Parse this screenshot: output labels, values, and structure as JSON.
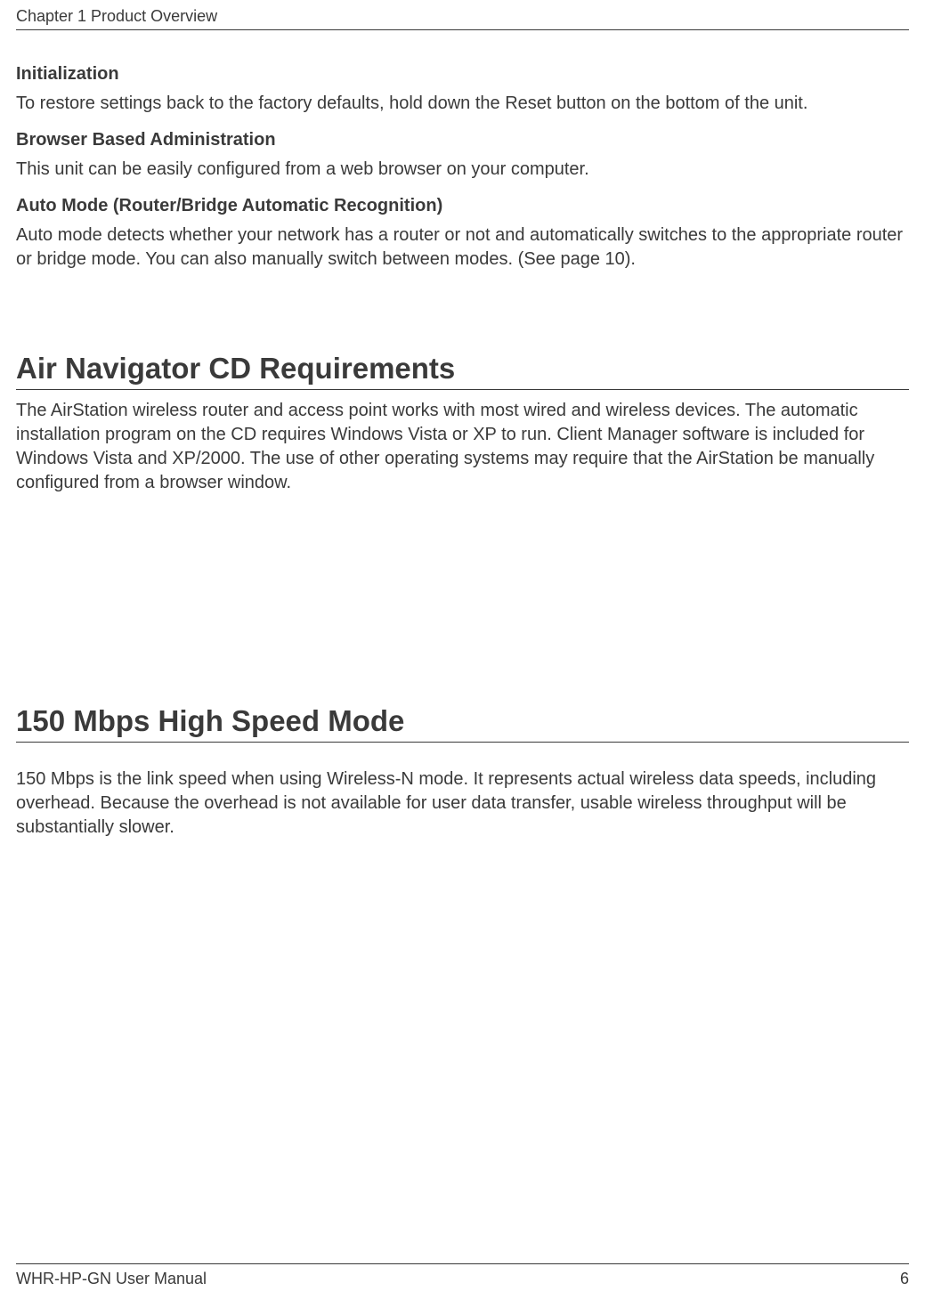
{
  "header": {
    "chapter_title": "Chapter 1  Product Overview"
  },
  "sections": {
    "initialization": {
      "heading": "Initialization",
      "body": "To restore settings back to the factory defaults, hold down the Reset button on the bottom of the unit."
    },
    "browser_admin": {
      "heading": "Browser Based Administration",
      "body": "This unit can be easily configured from a web browser on your computer."
    },
    "auto_mode": {
      "heading": "Auto Mode (Router/Bridge Automatic Recognition)",
      "body": "Auto mode detects whether your network has a router or not and automatically switches to the appropriate router or bridge mode. You can also manually switch between modes. (See page 10)."
    },
    "air_navigator": {
      "heading": "Air Navigator CD Requirements",
      "body": "The AirStation wireless router and access point works with most wired and wireless devices.  The automatic installation program on the CD requires Windows Vista or XP to run. Client Manager software is included for Windows Vista and XP/2000. The use of other operating systems may require that the AirStation be manually configured from a browser window."
    },
    "speed_mode": {
      "heading": "150 Mbps High Speed Mode",
      "body": "150 Mbps is the link speed when using Wireless-N mode. It represents actual wireless data speeds, including overhead. Because the overhead is not available for user data transfer, usable wireless throughput will be substantially slower."
    }
  },
  "footer": {
    "manual_name": "WHR-HP-GN User Manual",
    "page_number": "6"
  }
}
